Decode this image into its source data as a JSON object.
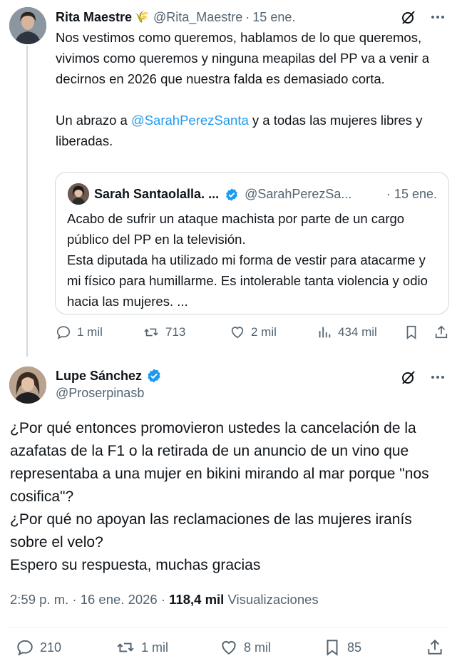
{
  "tweet1": {
    "name": "Rita Maestre",
    "badge_emoji": "🌾",
    "handle": "@Rita_Maestre",
    "separator": "·",
    "date": "15 ene.",
    "text_before_mention": "Nos vestimos como queremos, hablamos de lo que queremos, vivimos como queremos y ninguna meapilas del PP va a venir a decirnos en 2026 que nuestra falda es demasiado corta.\n\nUn abrazo a ",
    "mention": "@SarahPerezSanta",
    "text_after_mention": " y a todas las mujeres libres y liberadas.",
    "quote": {
      "name": "Sarah Santaolalla. ...",
      "handle": "@SarahPerezSa...",
      "date": "· 15 ene.",
      "text": "Acabo de sufrir un ataque machista por parte de un cargo público del PP en la televisión.\nEsta diputada ha utilizado mi forma de vestir para atacarme y mi físico para humillarme. Es intolerable tanta violencia y odio hacia las mujeres. ..."
    },
    "actions": {
      "replies": "1 mil",
      "reposts": "713",
      "likes": "2 mil",
      "views": "434 mil"
    }
  },
  "tweet2": {
    "name": "Lupe Sánchez",
    "handle": "@Proserpinasb",
    "text": "¿Por qué entonces promovieron ustedes la cancelación de la azafatas de la F1 o la retirada de un anuncio de un vino que representaba a una mujer en bikini mirando al mar porque \"nos cosifica\"?\n¿Por qué no apoyan las reclamaciones de las mujeres iranís sobre el velo?\nEspero su respuesta, muchas gracias",
    "time": "2:59 p. m. · 16 ene. 2026 · ",
    "views_count": "118,4 mil",
    "views_label": " Visualizaciones",
    "actions": {
      "replies": "210",
      "reposts": "1 mil",
      "likes": "8 mil",
      "bookmarks": "85"
    }
  },
  "colors": {
    "accent": "#1d9bf0",
    "muted": "#536471",
    "verified": "#1d9bf0",
    "border": "#cfd9de"
  }
}
